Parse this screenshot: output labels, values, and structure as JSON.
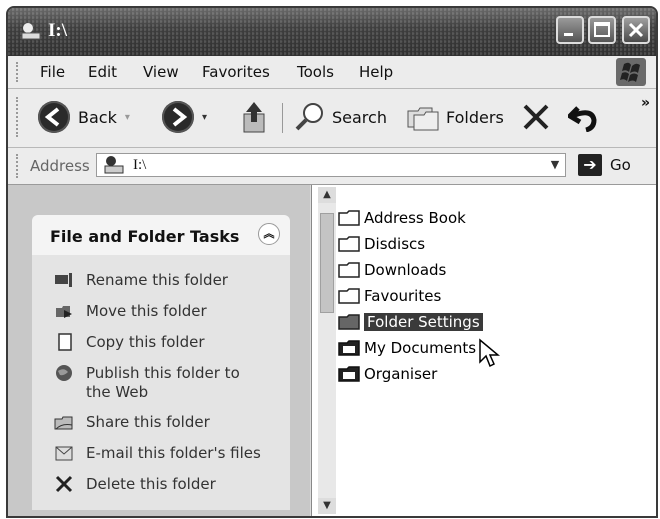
{
  "window": {
    "title": "I:\\"
  },
  "menu": [
    {
      "label": "File"
    },
    {
      "label": "Edit"
    },
    {
      "label": "View"
    },
    {
      "label": "Favorites"
    },
    {
      "label": "Tools"
    },
    {
      "label": "Help"
    }
  ],
  "toolbar": {
    "back_label": "Back",
    "search_label": "Search",
    "folders_label": "Folders",
    "more": "»"
  },
  "address": {
    "label": "Address",
    "value": "I:\\",
    "go_label": "Go"
  },
  "tasks": {
    "title": "File and Folder Tasks",
    "items": [
      {
        "label": "Rename this folder",
        "icon": "rename-icon"
      },
      {
        "label": "Move this folder",
        "icon": "move-icon"
      },
      {
        "label": "Copy this folder",
        "icon": "copy-icon"
      },
      {
        "label": "Publish this folder to the Web",
        "icon": "globe-icon"
      },
      {
        "label": "Share this folder",
        "icon": "share-icon"
      },
      {
        "label": "E-mail this folder's files",
        "icon": "email-icon"
      },
      {
        "label": "Delete this folder",
        "icon": "delete-icon"
      }
    ]
  },
  "files": [
    {
      "name": "Address Book",
      "selected": false
    },
    {
      "name": "Disdiscs",
      "selected": false
    },
    {
      "name": "Downloads",
      "selected": false
    },
    {
      "name": "Favourites",
      "selected": false
    },
    {
      "name": "Folder Settings",
      "selected": true
    },
    {
      "name": "My Documents",
      "selected": false
    },
    {
      "name": "Organiser",
      "selected": false
    }
  ]
}
